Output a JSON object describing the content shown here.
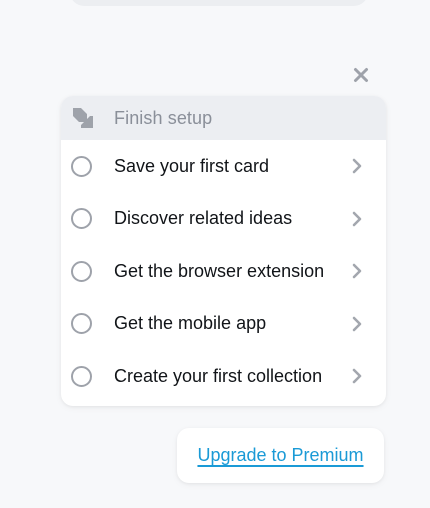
{
  "colors": {
    "background": "#f7f8fa",
    "header_bg": "#eceef2",
    "header_text": "#8a8f99",
    "task_text": "#111418",
    "radio_border": "#9ea2aa",
    "chevron": "#a3a7ae",
    "link": "#1a9ad6"
  },
  "icons": {
    "close": "close-icon",
    "header": "arrow-down-right-icon",
    "task_status": "radio-empty-icon",
    "task_arrow": "chevron-right-icon"
  },
  "setup": {
    "title": "Finish setup",
    "tasks": [
      {
        "label": "Save your first card",
        "done": false
      },
      {
        "label": "Discover related ideas",
        "done": false
      },
      {
        "label": "Get the browser extension",
        "done": false
      },
      {
        "label": "Get the mobile app",
        "done": false
      },
      {
        "label": "Create your first collection",
        "done": false
      }
    ]
  },
  "upgrade": {
    "label": "Upgrade to Premium"
  }
}
